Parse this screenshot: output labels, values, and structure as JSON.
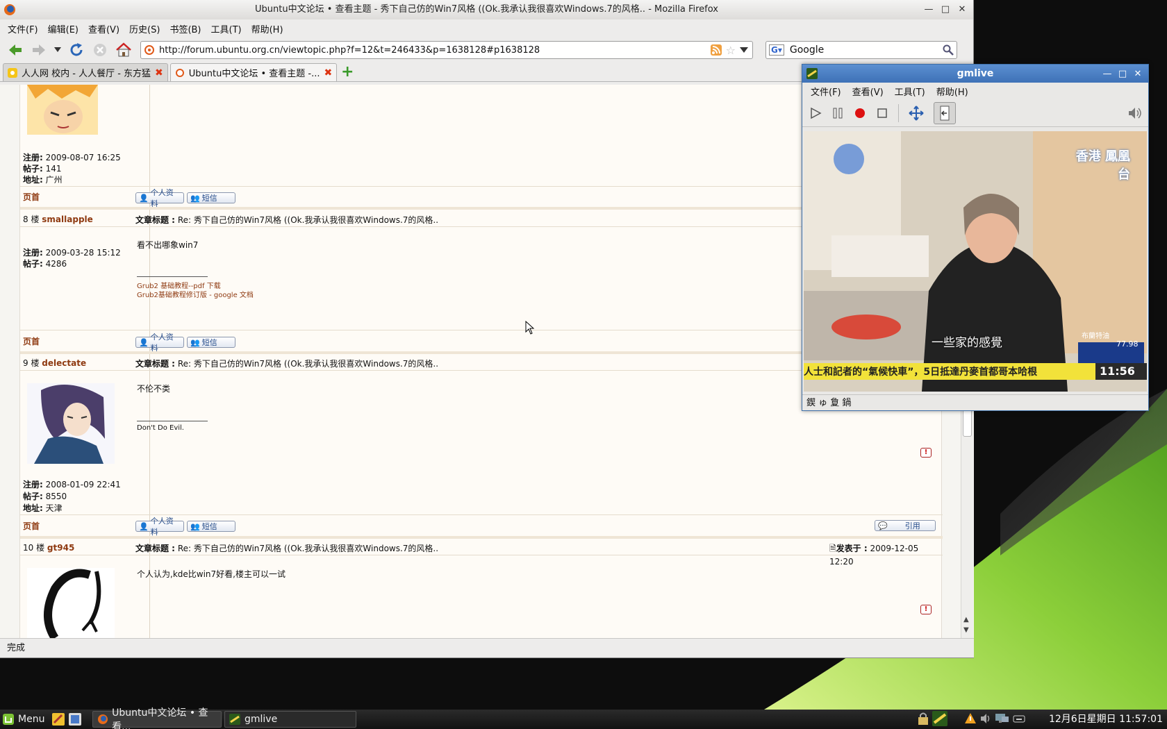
{
  "firefox": {
    "title": "Ubuntu中文论坛 • 查看主题 - 秀下自己仿的Win7风格 ((Ok.我承认我很喜欢Windows.7的风格.. - Mozilla Firefox",
    "menu": [
      "文件(F)",
      "编辑(E)",
      "查看(V)",
      "历史(S)",
      "书签(B)",
      "工具(T)",
      "帮助(H)"
    ],
    "url": "http://forum.ubuntu.org.cn/viewtopic.php?f=12&t=246433&p=1638128#p1638128",
    "search_value": "Google",
    "tabs": [
      {
        "label": "人人网 校内 - 人人餐厅 - 东方猛"
      },
      {
        "label": "Ubuntu中文论坛 • 查看主题 -..."
      }
    ],
    "status": "完成"
  },
  "forum": {
    "top_profile": {
      "reg_label": "注册:",
      "reg": "2009-08-07 16:25",
      "posts_label": "帖子:",
      "posts": "141",
      "addr_label": "地址:",
      "addr": "广州"
    },
    "page_top": "页首",
    "profile_btn": "个人资料",
    "pm_btn": "短信",
    "quote_btn": "引用",
    "subject_label": "文章标题 :",
    "posted_label": "发表于 :",
    "posts": [
      {
        "floor": "8 楼",
        "user": "smallapple",
        "subject": "Re: 秀下自己仿的Win7风格 ((Ok.我承认我很喜欢Windows.7的风格..",
        "reg": "2009-03-28 15:12",
        "posts": "4286",
        "body": "看不出哪象win7",
        "sig1": "Grub2 基础教程--pdf 下载",
        "sig2": "Grub2基础教程修订版 - google 文档"
      },
      {
        "floor": "9 楼",
        "user": "delectate",
        "subject": "Re: 秀下自己仿的Win7风格 ((Ok.我承认我很喜欢Windows.7的风格..",
        "reg": "2008-01-09 22:41",
        "posts": "8550",
        "addr": "天津",
        "body": "不伦不类",
        "sig1": "Don't Do Evil."
      },
      {
        "floor": "10 楼",
        "user": "gt945",
        "subject": "Re: 秀下自己仿的Win7风格 ((Ok.我承认我很喜欢Windows.7的风格..",
        "date": "2009-12-05 12:20",
        "body": "个人认为,kde比win7好看,楼主可以一试"
      }
    ]
  },
  "gmlive": {
    "title": "gmlive",
    "menu": [
      "文件(F)",
      "查看(V)",
      "工具(T)",
      "帮助(H)"
    ],
    "status": "鍥 ゅ 夐  鍋",
    "video": {
      "logo_text": "香港 鳳凰台",
      "subtitle": "一些家的感覺",
      "ticker": "人士和記者的“氣候快車”，5日抵達丹麥首都哥本哈根",
      "time": "11:56",
      "price_label": "布蘭特油",
      "price": "77.98"
    }
  },
  "taskbar": {
    "menu_label": "Menu",
    "tasks": [
      {
        "label": "Ubuntu中文论坛 • 查看..."
      },
      {
        "label": "gmlive"
      }
    ],
    "clock": "12月6日星期日 11:57:01"
  },
  "colors": {
    "link": "#8f3a11",
    "gm_title": "#3e71b7",
    "desktop_green": "#7cc234"
  }
}
